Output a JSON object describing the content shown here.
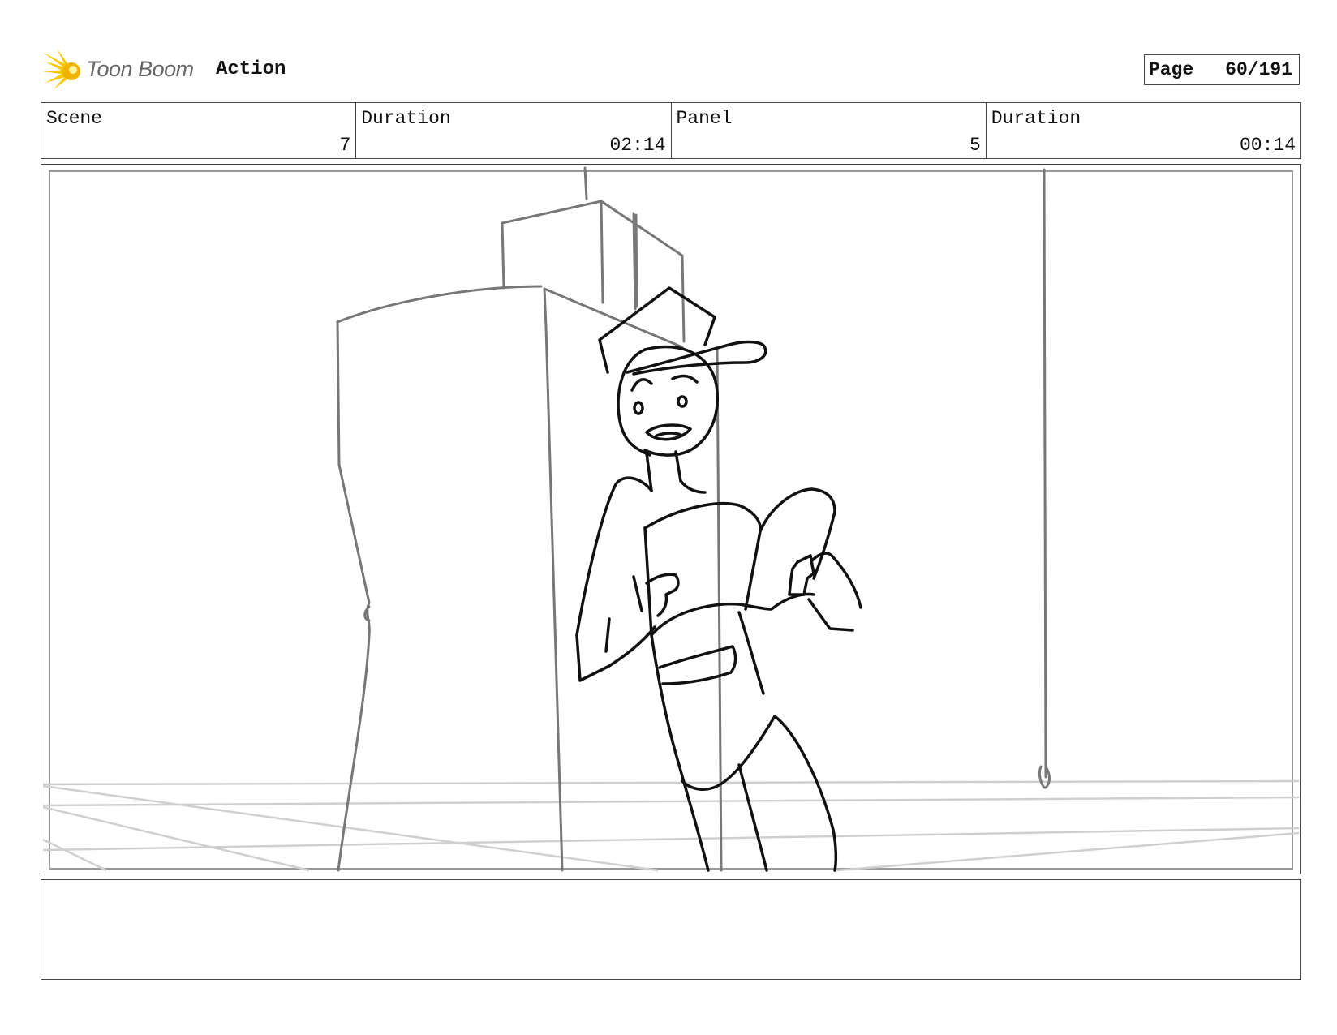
{
  "header": {
    "logo_text": "Toon Boom",
    "action_label": "Action",
    "page_label": "Page",
    "page_value": "60/191"
  },
  "info": {
    "scene_label": "Scene",
    "scene_value": "7",
    "scene_duration_label": "Duration",
    "scene_duration_value": "02:14",
    "panel_label": "Panel",
    "panel_value": "5",
    "panel_duration_label": "Duration",
    "panel_duration_value": "00:14"
  },
  "notes": {
    "text": ""
  },
  "colors": {
    "logo_yellow": "#f5c800",
    "logo_orange": "#f0a000",
    "border": "#444444"
  }
}
